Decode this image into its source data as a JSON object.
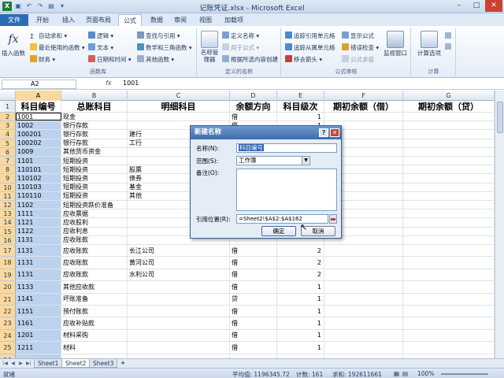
{
  "window": {
    "title": "记账凭证.xlsx - Microsoft Excel",
    "controls": [
      "–",
      "□",
      "✕"
    ]
  },
  "tabs": [
    "文件",
    "开始",
    "插入",
    "页面布局",
    "公式",
    "数据",
    "审阅",
    "视图",
    "加载项"
  ],
  "active_tab": "公式",
  "ribbon": {
    "insert_function": "插入函数",
    "func_library": {
      "autosum": "自动求和",
      "recent": "最近使用的函数",
      "finance": "财务",
      "logic": "逻辑",
      "text": "文本",
      "datetime": "日期和时间",
      "lookup": "查找与引用",
      "math": "数学和三角函数",
      "other": "其他函数",
      "label": "函数库"
    },
    "defined_names": {
      "manager": "名称管理器",
      "define": "定义名称",
      "use_in_formula": "用于公式",
      "create_from_selection": "根据所选内容创建",
      "label": "定义的名称"
    },
    "audit": {
      "trace_precedents": "追踪引用单元格",
      "trace_dependents": "追踪从属单元格",
      "remove_arrows": "移去箭头",
      "show_formulas": "显示公式",
      "error_check": "错误检查",
      "evaluate": "公式求值",
      "watch": "监视窗口",
      "label": "公式审核"
    },
    "calc": {
      "options": "计算选项",
      "label": "计算"
    }
  },
  "formula_bar": {
    "name_box": "A2",
    "fx": "fx",
    "value": "1001"
  },
  "columns": [
    "A",
    "B",
    "C",
    "D",
    "E",
    "F",
    "G"
  ],
  "header_row": [
    "科目编号",
    "总账科目",
    "明细科目",
    "余额方向",
    "科目级次",
    "期初余额（借）",
    "期初余额（贷）"
  ],
  "rows": [
    {
      "n": "2",
      "a": "1001",
      "b": "现金",
      "c": "",
      "d": "借",
      "e": "1"
    },
    {
      "n": "3",
      "a": "1002",
      "b": "银行存款",
      "c": "",
      "d": "借",
      "e": "1"
    },
    {
      "n": "4",
      "a": "100201",
      "b": "银行存款",
      "c": "建行",
      "d": "借",
      "e": ""
    },
    {
      "n": "5",
      "a": "100202",
      "b": "银行存款",
      "c": "工行",
      "d": "借",
      "e": ""
    },
    {
      "n": "6",
      "a": "1009",
      "b": "其他货币资金",
      "c": "",
      "d": "",
      "e": ""
    },
    {
      "n": "7",
      "a": "1101",
      "b": "短期投资",
      "c": "",
      "d": "",
      "e": ""
    },
    {
      "n": "8",
      "a": "110101",
      "b": "短期投资",
      "c": "股票",
      "d": "",
      "e": ""
    },
    {
      "n": "9",
      "a": "110102",
      "b": "短期投资",
      "c": "债券",
      "d": "",
      "e": ""
    },
    {
      "n": "10",
      "a": "110103",
      "b": "短期投资",
      "c": "基金",
      "d": "",
      "e": ""
    },
    {
      "n": "11",
      "a": "110110",
      "b": "短期投资",
      "c": "其他",
      "d": "",
      "e": ""
    },
    {
      "n": "12",
      "a": "1102",
      "b": "短期投资跌价准备",
      "c": "",
      "d": "",
      "e": ""
    },
    {
      "n": "13",
      "a": "1111",
      "b": "应收票据",
      "c": "",
      "d": "",
      "e": ""
    },
    {
      "n": "14",
      "a": "1121",
      "b": "应收股利",
      "c": "",
      "d": "",
      "e": ""
    },
    {
      "n": "15",
      "a": "1122",
      "b": "应收利息",
      "c": "",
      "d": "",
      "e": ""
    },
    {
      "n": "16",
      "a": "1131",
      "b": "应收账款",
      "c": "",
      "d": "",
      "e": ""
    },
    {
      "n": "17",
      "a": "1131",
      "b": "应收账款",
      "c": "长江公司",
      "d": "借",
      "e": "2"
    },
    {
      "n": "18",
      "a": "1131",
      "b": "应收账款",
      "c": "黄河公司",
      "d": "借",
      "e": "2"
    },
    {
      "n": "19",
      "a": "1131",
      "b": "应收账款",
      "c": "水利公司",
      "d": "借",
      "e": "2"
    },
    {
      "n": "20",
      "a": "1133",
      "b": "其他应收款",
      "c": "",
      "d": "借",
      "e": "1"
    },
    {
      "n": "21",
      "a": "1141",
      "b": "坏账准备",
      "c": "",
      "d": "贷",
      "e": "1"
    },
    {
      "n": "22",
      "a": "1151",
      "b": "预付账款",
      "c": "",
      "d": "借",
      "e": "1"
    },
    {
      "n": "23",
      "a": "1161",
      "b": "应收补贴款",
      "c": "",
      "d": "借",
      "e": "1"
    },
    {
      "n": "24",
      "a": "1201",
      "b": "材料采购",
      "c": "",
      "d": "借",
      "e": "1"
    },
    {
      "n": "25",
      "a": "1211",
      "b": "材料",
      "c": "",
      "d": "借",
      "e": "1"
    },
    {
      "n": "26",
      "a": "",
      "b": "",
      "c": "",
      "d": "",
      "e": ""
    }
  ],
  "dialog": {
    "title": "新建名称",
    "help": "?",
    "close": "✕",
    "name_label": "名称(N):",
    "name_value": "科目编号",
    "scope_label": "范围(S):",
    "scope_value": "工作簿",
    "comment_label": "备注(O):",
    "ref_label": "引用位置(R):",
    "ref_value": "=Sheet2!$A$2:$A$162",
    "ok": "确定",
    "cancel": "取消"
  },
  "sheets": [
    "Sheet1",
    "Sheet2",
    "Sheet3"
  ],
  "active_sheet": "Sheet2",
  "status": {
    "mode": "就绪",
    "average": "平均值: 1196345.72",
    "count": "计数: 161",
    "sum": "求和: 192611661",
    "zoom": "100%"
  }
}
